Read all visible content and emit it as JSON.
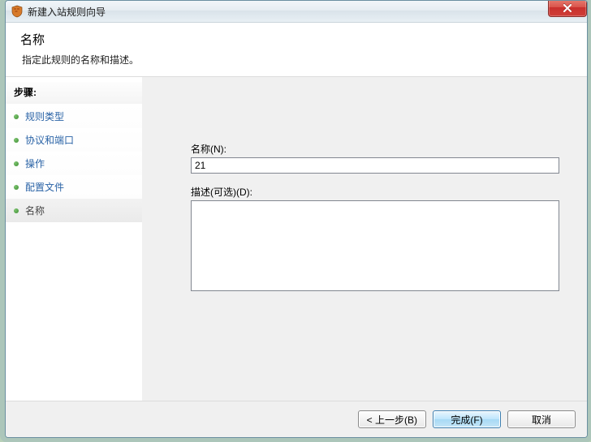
{
  "window": {
    "title": "新建入站规则向导"
  },
  "header": {
    "title": "名称",
    "subtitle": "指定此规则的名称和描述。"
  },
  "sidebar": {
    "steps_label": "步骤:",
    "items": [
      {
        "label": "规则类型",
        "current": false
      },
      {
        "label": "协议和端口",
        "current": false
      },
      {
        "label": "操作",
        "current": false
      },
      {
        "label": "配置文件",
        "current": false
      },
      {
        "label": "名称",
        "current": true
      }
    ]
  },
  "form": {
    "name_label": "名称(N):",
    "name_value": "21",
    "desc_label": "描述(可选)(D):",
    "desc_value": ""
  },
  "footer": {
    "back": "< 上一步(B)",
    "finish": "完成(F)",
    "cancel": "取消"
  }
}
